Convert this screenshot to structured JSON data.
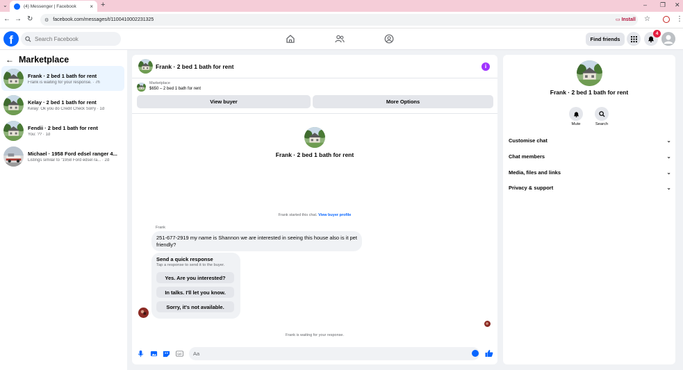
{
  "browser": {
    "tab_title": "(4) Messenger | Facebook",
    "tab_close": "×",
    "new_tab": "+",
    "url": "facebook.com/messages/t/1100410002231325",
    "install_label": "Install",
    "minimize": "–",
    "restore": "❐",
    "close": "✕"
  },
  "fb_top": {
    "logo": "f",
    "search_placeholder": "Search Facebook",
    "find_friends": "Find friends",
    "notification_count": "4"
  },
  "left": {
    "title": "Marketplace",
    "conversations": [
      {
        "name": "Frank · 2 bed 1 bath for rent",
        "preview": "Frank is waiting for your response. · 7h",
        "active": true
      },
      {
        "name": "Kelay · 2 bed 1 bath for rent",
        "preview": "Kelay: Ok you do Credit Check Sorry · 1d",
        "active": false
      },
      {
        "name": "Fendii · 2 bed 1 bath for rent",
        "preview": "You: ?? · 1d",
        "active": false
      },
      {
        "name": "Michael · 1958 Ford edsel ranger 4...",
        "preview": "Listings similar to \"1958 Ford edsel ra... · 2d",
        "active": false
      }
    ]
  },
  "chat": {
    "header_name": "Frank · 2 bed 1 bath for rent",
    "info_glyph": "i",
    "marketplace_label": "Marketplace",
    "listing": "$650 – 2 bed 1 bath for rent",
    "view_buyer": "View buyer",
    "more_options": "More Options",
    "center_name": "Frank · 2 bed 1 bath for rent",
    "started_text": "Frank started this chat.",
    "view_buyer_profile": "View buyer profile",
    "sender": "Frank",
    "message": "251-677-2919 my name is Shannon we are interested in seeing this house also is it pet friendly?",
    "quick_title": "Send a quick response",
    "quick_sub": "Tap a response to send it to the buyer.",
    "quick_responses": [
      "Yes. Are you interested?",
      "In talks. I'll let you know.",
      "Sorry, it's not available."
    ],
    "waiting_text": "Frank is waiting for your response.",
    "composer_placeholder": "Aa"
  },
  "right": {
    "name": "Frank · 2 bed 1 bath for rent",
    "mute": "Mute",
    "search": "Search",
    "sections": [
      "Customise chat",
      "Chat members",
      "Media, files and links",
      "Privacy & support"
    ]
  },
  "colors": {
    "brand": "#0866ff",
    "info": "#a033ff",
    "badge": "#e41e3f",
    "tabbar": "#f5cdd8"
  }
}
